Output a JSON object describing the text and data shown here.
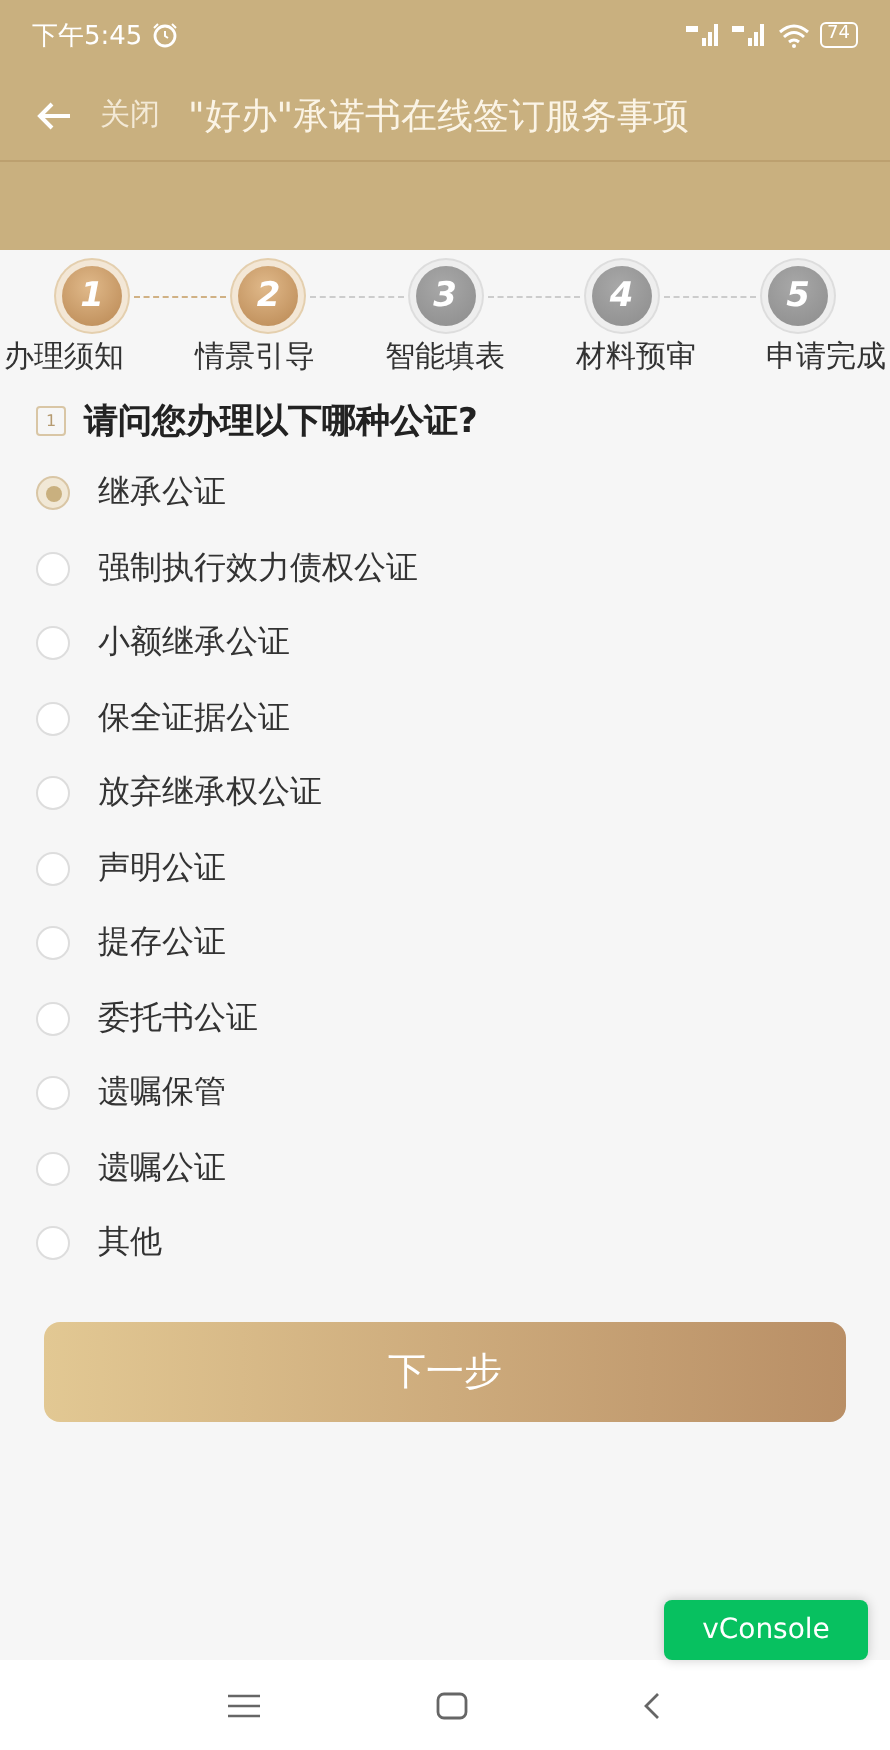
{
  "status_bar": {
    "time": "下午5:45",
    "battery": "74"
  },
  "header": {
    "back_label": "关闭",
    "title": "\"好办\"承诺书在线签订服务事项"
  },
  "steps": [
    {
      "number": "1",
      "label": "办理须知",
      "done": true
    },
    {
      "number": "2",
      "label": "情景引导",
      "done": true
    },
    {
      "number": "3",
      "label": "智能填表",
      "done": false
    },
    {
      "number": "4",
      "label": "材料预审",
      "done": false
    },
    {
      "number": "5",
      "label": "申请完成",
      "done": false
    }
  ],
  "question": {
    "number": "1",
    "text": "请问您办理以下哪种公证?"
  },
  "options": [
    {
      "label": "继承公证",
      "selected": true
    },
    {
      "label": "强制执行效力债权公证",
      "selected": false
    },
    {
      "label": "小额继承公证",
      "selected": false
    },
    {
      "label": "保全证据公证",
      "selected": false
    },
    {
      "label": "放弃继承权公证",
      "selected": false
    },
    {
      "label": "声明公证",
      "selected": false
    },
    {
      "label": "提存公证",
      "selected": false
    },
    {
      "label": "委托书公证",
      "selected": false
    },
    {
      "label": "遗嘱保管",
      "selected": false
    },
    {
      "label": "遗嘱公证",
      "selected": false
    },
    {
      "label": "其他",
      "selected": false
    }
  ],
  "next_button": "下一步",
  "vconsole_button": "vConsole"
}
